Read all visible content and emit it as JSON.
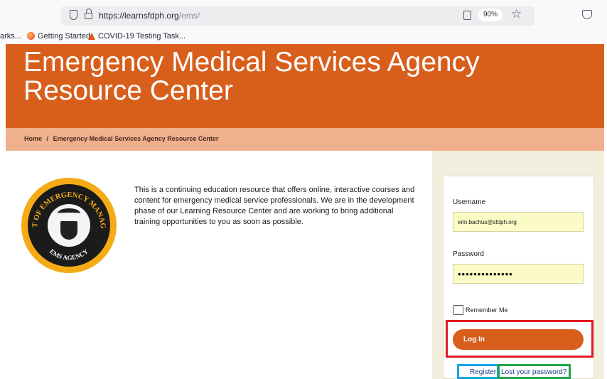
{
  "browser": {
    "url_host": "https://learnsfdph.org",
    "url_path": "/ems/",
    "zoom": "90%",
    "bookmarks": [
      {
        "label": "arks..."
      },
      {
        "label": "Getting Started"
      },
      {
        "label": "COVID-19 Testing Task..."
      }
    ]
  },
  "page": {
    "title": "Emergency Medical Services Agency Resource Center",
    "breadcrumb": {
      "home": "Home",
      "separator": "/",
      "current": "Emergency Medical Services Agency Resource Center"
    },
    "seal": {
      "top_text": "S.F. DEPT OF EMERGENCY MANAGEMENT",
      "bottom_text": "EMS AGENCY"
    },
    "intro": "This is a continuing education resource that offers online, interactive courses and content for emergency medical service professionals. We are in the development phase of our Learning Resource Center and are working to bring additional training opportunities to you as soon as possible."
  },
  "login": {
    "username_label": "Username",
    "username_value": "erin.bachus@sfdph.org",
    "password_label": "Password",
    "password_value": "••••••••••••••",
    "remember_label": "Remember Me",
    "login_button": "Log In",
    "register_link": "Register",
    "lost_password_link": "Lost your password?"
  },
  "colors": {
    "brand_orange": "#d85e1c",
    "breadcrumb_bg": "#f0b08e",
    "field_bg": "#fbfbc6",
    "highlight_red": "#e11b22",
    "highlight_blue": "#1aa3e0",
    "highlight_green": "#1fa84a"
  }
}
